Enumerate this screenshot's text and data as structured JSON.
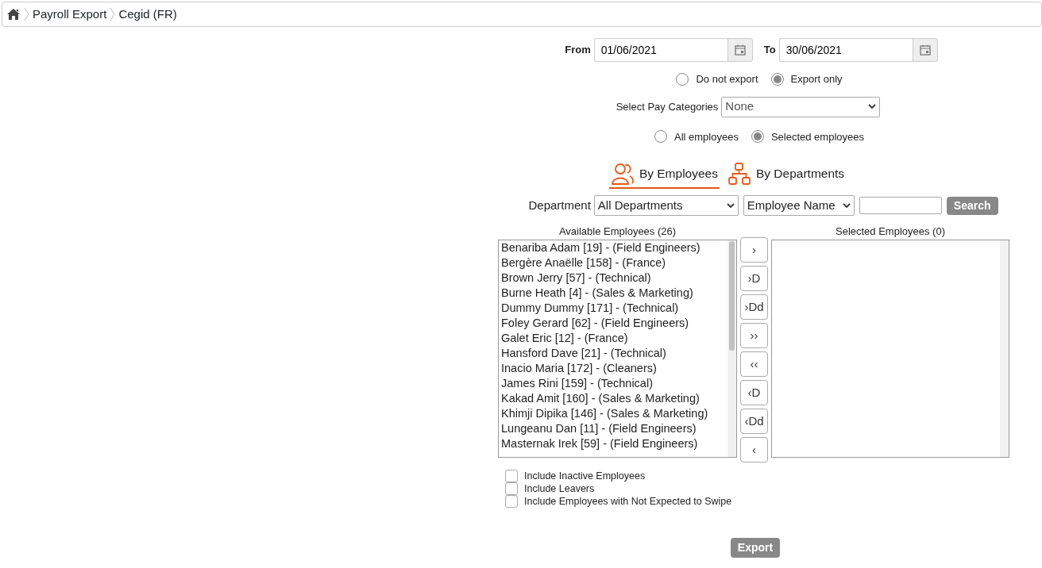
{
  "breadcrumb": [
    "Payroll Export",
    "Cegid (FR)"
  ],
  "date_range": {
    "from_label": "From",
    "from_value": "01/06/2021",
    "to_label": "To",
    "to_value": "30/06/2021"
  },
  "export_options": [
    {
      "label": "Do not export",
      "selected": false
    },
    {
      "label": "Export only",
      "selected": true
    }
  ],
  "pay_categories": {
    "label": "Select Pay Categories",
    "value": "None"
  },
  "employee_scope": [
    {
      "label": "All employees",
      "selected": false
    },
    {
      "label": "Selected employees",
      "selected": true
    }
  ],
  "view_tabs": [
    {
      "label": "By Employees",
      "kind": "people",
      "selected": true
    },
    {
      "label": "By Departments",
      "kind": "hierarchy",
      "selected": false
    }
  ],
  "filter": {
    "label": "Department",
    "department": "All Departments",
    "field": "Employee Name",
    "search_button": "Search"
  },
  "available": {
    "title": "Available Employees (26)",
    "items": [
      "Benariba Adam [19] - (Field Engineers)",
      "Bergère Anaëlle [158] - (France)",
      "Brown Jerry [57] - (Technical)",
      "Burne Heath [4] - (Sales & Marketing)",
      "Dummy Dummy [171] - (Technical)",
      "Foley Gerard [62] - (Field Engineers)",
      "Galet Eric [12] - (France)",
      "Hansford Dave [21] - (Technical)",
      "Inacio Maria [172] - (Cleaners)",
      "James Rini [159] - (Technical)",
      "Kakad Amit [160] - (Sales & Marketing)",
      "Khimji Dipika [146] - (Sales & Marketing)",
      "Lungeanu Dan [11] - (Field Engineers)",
      "Masternak Irek [59] - (Field Engineers)"
    ]
  },
  "transfer_buttons": [
    "›",
    "›D",
    "›Dd",
    "››",
    "‹‹",
    "‹D",
    "‹Dd",
    "‹"
  ],
  "selected": {
    "title": "Selected Employees (0)"
  },
  "include_options": [
    {
      "label": "Include Inactive Employees",
      "checked": false
    },
    {
      "label": "Include Leavers",
      "checked": false
    },
    {
      "label": "Include Employees with Not Expected to Swipe",
      "checked": false
    }
  ],
  "export_button": "Export"
}
